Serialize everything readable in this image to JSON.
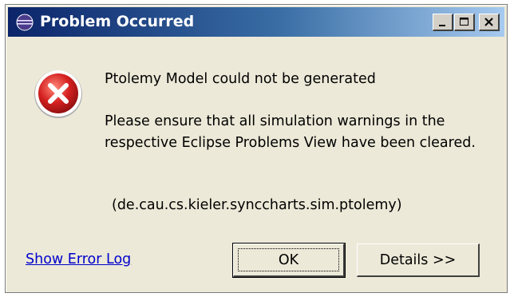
{
  "window": {
    "title": "Problem Occurred",
    "icons": {
      "app": "eclipse-icon",
      "minimize": "minimize-icon",
      "maximize": "maximize-icon",
      "close": "close-icon"
    }
  },
  "message": {
    "icon": "error-icon",
    "title": "Ptolemy Model could not be generated",
    "body": "Please ensure that all simulation warnings in the respective Eclipse Problems View have been cleared.",
    "plugin": "(de.cau.cs.kieler.synccharts.sim.ptolemy)"
  },
  "footer": {
    "link_label": "Show Error Log",
    "ok_label": "OK",
    "details_label": "Details >>"
  },
  "colors": {
    "titlebar_start": "#0b246a",
    "titlebar_end": "#a6caf0",
    "dialog_bg": "#ece9d8",
    "error_red": "#d42020",
    "link": "#0000cc"
  }
}
